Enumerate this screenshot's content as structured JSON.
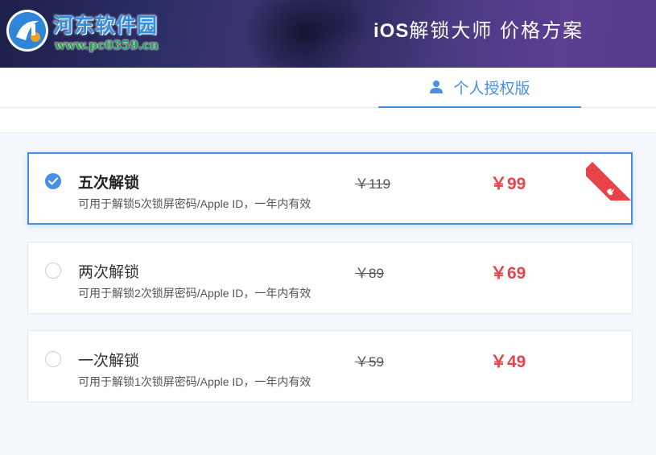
{
  "header": {
    "logo_text": "河东软件园",
    "logo_url": "www.pc0359.cn",
    "title_ios": "iOS",
    "title_rest": "解锁大师 价格方案"
  },
  "tabs": [
    {
      "label": "个人授权版",
      "icon": "user-icon",
      "active": true
    }
  ],
  "plans": [
    {
      "name": "五次解锁",
      "desc": "可用于解锁5次锁屏密码/Apple ID，一年内有效",
      "old_price": "￥119",
      "price": "￥99",
      "selected": true,
      "badge": "hot"
    },
    {
      "name": "两次解锁",
      "desc": "可用于解锁2次锁屏密码/Apple ID，一年内有效",
      "old_price": "￥89",
      "price": "￥69",
      "selected": false
    },
    {
      "name": "一次解锁",
      "desc": "可用于解锁1次锁屏密码/Apple ID，一年内有效",
      "old_price": "￥59",
      "price": "￥49",
      "selected": false
    }
  ],
  "colors": {
    "accent": "#4a8fe7",
    "price": "#e9434a",
    "header_bg": "#2a2d63"
  }
}
